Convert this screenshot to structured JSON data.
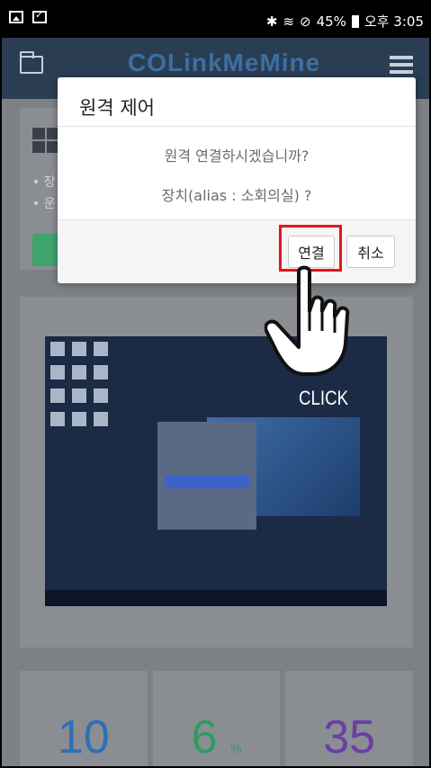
{
  "status_bar": {
    "battery": "45%",
    "time": "오후 3:05"
  },
  "app_header": {
    "logo": "LinkMeMine",
    "logo_prefix": "CO"
  },
  "background": {
    "bullet_1": "• 장",
    "bullet_2": "• 운",
    "stats": [
      {
        "value": "10",
        "unit": "",
        "color": "#2f6fb5"
      },
      {
        "value": "6",
        "unit": "%",
        "color": "#2e9b62"
      },
      {
        "value": "35",
        "unit": "",
        "color": "#6a3fa5"
      }
    ]
  },
  "dialog": {
    "title": "원격 제어",
    "message": "원격 연결하시겠습니까?",
    "device_line": "장치(alias : 소회의실) ?",
    "connect_label": "연결",
    "cancel_label": "취소"
  },
  "annotation": {
    "click_label": "CLICK",
    "highlight_color": "#e4141b"
  }
}
